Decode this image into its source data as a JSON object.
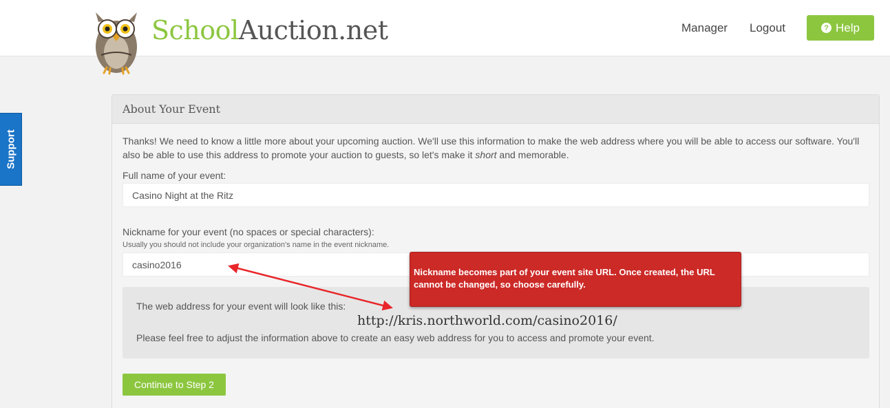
{
  "header": {
    "brand_part1": "School",
    "brand_part2": "Auction.net",
    "nav_manager": "Manager",
    "nav_logout": "Logout",
    "help_label": "Help",
    "help_icon_glyph": "?"
  },
  "support_tab": {
    "label": "Support"
  },
  "panel": {
    "title": "About Your Event",
    "intro_before": "Thanks! We need to know a little more about your upcoming auction. We'll use this information to make the web address where you will be able to access our software. You'll also be able to use this address to promote your auction to guests, so let's make it ",
    "intro_em": "short",
    "intro_after": " and memorable.",
    "full_name_label": "Full name of your event:",
    "full_name_value": "Casino Night at the Ritz",
    "nickname_label": "Nickname for your event (no spaces or special characters):",
    "nickname_hint": "Usually you should not include your organization's name in the event nickname.",
    "nickname_value": "casino2016",
    "url_intro": "The web address for your event will look like this:",
    "url_value": "http://kris.northworld.com/casino2016/",
    "url_adjust": "Please feel free to adjust the information above to create an easy web address for you to access and promote your event.",
    "continue_label": "Continue to Step 2"
  },
  "callout": {
    "text": "Nickname becomes part of your event site URL.  Once created, the URL cannot be changed, so choose carefully."
  },
  "colors": {
    "brand_green": "#8cc63f",
    "support_blue": "#1a74c7",
    "callout_red": "#cc2a27",
    "arrow_red": "#e8262a"
  }
}
